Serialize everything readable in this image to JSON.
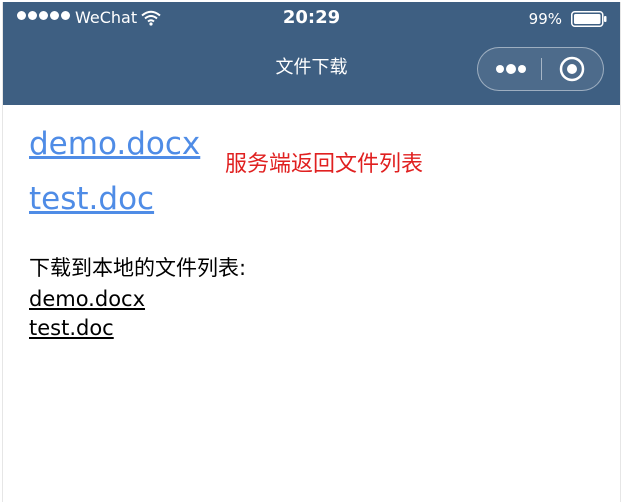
{
  "status_bar": {
    "carrier": "WeChat",
    "time": "20:29",
    "battery_percent": "99%"
  },
  "nav": {
    "title": "文件下载",
    "capsule_icons": [
      "more-icon",
      "close-target-icon"
    ]
  },
  "remote_files": {
    "annotation": "服务端返回文件列表",
    "items": [
      {
        "label": "demo.docx"
      },
      {
        "label": "test.doc"
      }
    ]
  },
  "local_files": {
    "heading": "下载到本地的文件列表:",
    "items": [
      {
        "label": "demo.docx"
      },
      {
        "label": "test.doc"
      }
    ]
  },
  "colors": {
    "header_bg": "#3e5f82",
    "link": "#4f8ce6",
    "annotation": "#e02020"
  }
}
